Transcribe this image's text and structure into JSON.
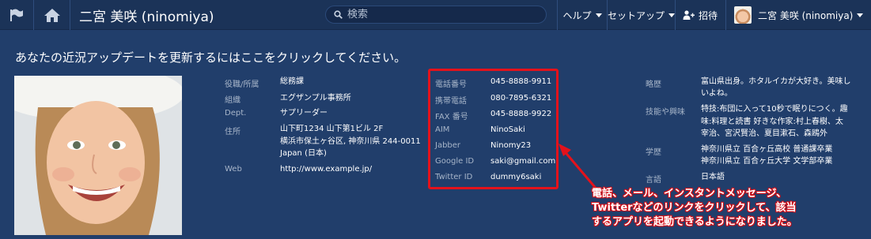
{
  "topbar": {
    "user_title": "二宮 美咲 (ninomiya)",
    "search_placeholder": "検索",
    "help_label": "ヘルプ",
    "setup_label": "セットアップ",
    "invite_label": "招待",
    "account_label": "二宮 美咲 (ninomiya)"
  },
  "update_link": "あなたの近況アップデートを更新するにはここをクリックしてください。",
  "col1": {
    "title_label": "役職/所属",
    "title_value": "総務課",
    "org_label": "組織",
    "org_value": "エグザンプル事務所",
    "dept_label": "Dept.",
    "dept_value": "サプリーダー",
    "address_label": "住所",
    "address_line1": "山下町1234 山下第1ビル 2F",
    "address_line2": "横浜市保土ヶ谷区, 神奈川県 244-0011",
    "address_line3": "Japan (日本)",
    "web_label": "Web",
    "web_value": "http://www.example.jp/"
  },
  "contact": {
    "phone_label": "電話番号",
    "phone_value": "045-8888-9911",
    "mobile_label": "携帯電話",
    "mobile_value": "080-7895-6321",
    "fax_label": "FAX 番号",
    "fax_value": "045-8888-9922",
    "aim_label": "AIM",
    "aim_value": "NinoSaki",
    "jabber_label": "Jabber",
    "jabber_value": "Ninomy23",
    "google_label": "Google ID",
    "google_value": "saki@gmail.com",
    "twitter_label": "Twitter ID",
    "twitter_value": "dummy6saki"
  },
  "col3": {
    "bio_label": "略歴",
    "bio_line1": "富山県出身。ホタルイカが大好き。美味し",
    "bio_line2": "いよね。",
    "skills_label": "技能や興味",
    "skills_line1": "特技:布団に入って10秒で眠りにつく。趣",
    "skills_line2": "味:料理と読書 好きな作家:村上春樹、太",
    "skills_line3": "宰治、宮沢賢治、夏目漱石、森鴎外",
    "edu_label": "学歴",
    "edu_line1": "神奈川県立 百合ヶ丘高校 普通課卒業",
    "edu_line2": "神奈川県立 百合ヶ丘大学 文学部卒業",
    "lang_label": "言語",
    "lang_value": "日本語"
  },
  "callout": {
    "line1": "電話、メール、インスタントメッセージ、",
    "line2": "Twitterなどのリンクをクリックして、該当",
    "line3": "するアプリを起動できるようになりました。"
  },
  "colors": {
    "background": "#213e6b",
    "topbar": "#1b3358",
    "accent_red": "#e4121b",
    "label": "#a7b5c9"
  },
  "icons": [
    "flag-icon",
    "home-icon",
    "search-icon",
    "add-user-icon",
    "caret-down-icon"
  ]
}
